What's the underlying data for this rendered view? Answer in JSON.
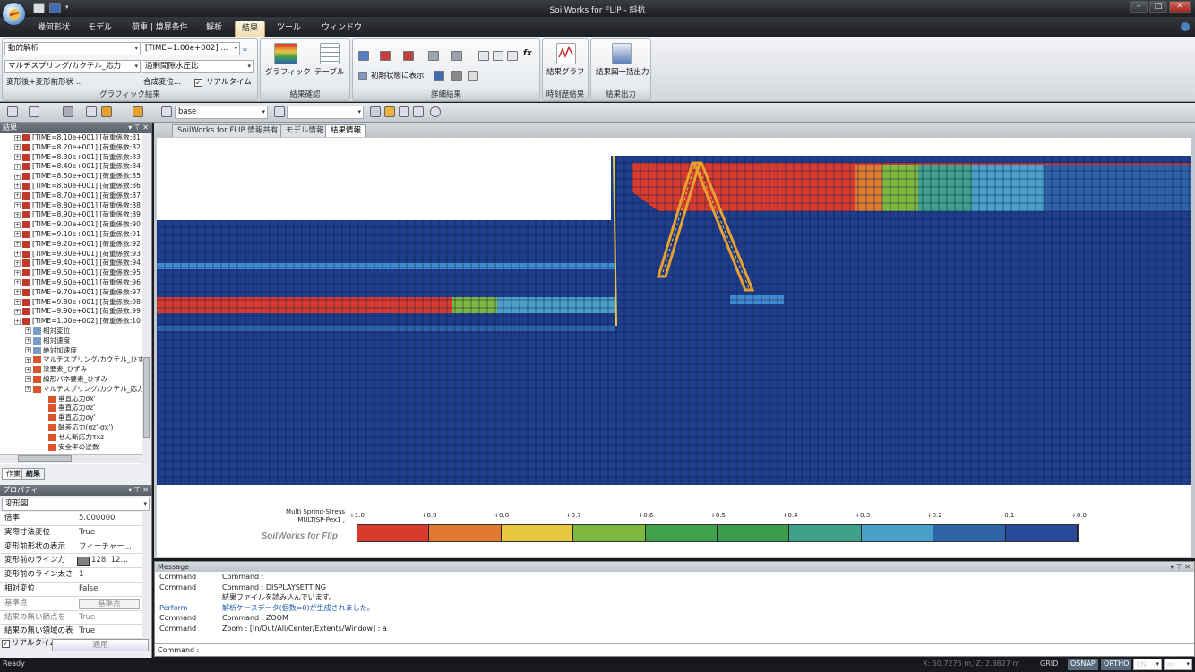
{
  "app": {
    "title": "SoilWorks for FLIP - 斜杭"
  },
  "ribbon": {
    "tabs": [
      "幾何形状",
      "モデル",
      "荷重 | 境界条件",
      "解析",
      "結果",
      "ツール",
      "ウィンドウ"
    ],
    "active_tab": "結果",
    "graphic_result": {
      "analysis_combo": "動的解析",
      "time_combo": "[TIME=1.00e+002]  ...",
      "component_combo": "マルチスプリング/カクテル_応力",
      "excess_combo": "過剰間隙水圧比",
      "shape_combo": "変形後+変形前形状 ...",
      "displacement_combo": "合成変位...",
      "realtime_label": "リアルタイム",
      "group_label": "グラフィック結果"
    },
    "result_check": {
      "graphic_label": "グラフィック",
      "table_label": "テーブル",
      "group_label": "結果確認"
    },
    "detail_result": {
      "show_initial_label": "初期状態に表示",
      "group_label": "詳細結果"
    },
    "timehistory": {
      "graph_label": "結果グラフ",
      "group_label": "時刻歴結果"
    },
    "output": {
      "batch_label": "結果図一括出力",
      "group_label": "結果出力"
    }
  },
  "toolbar": {
    "layer_combo": "base"
  },
  "result_panel": {
    "title": "結果",
    "rows": [
      "[TIME=8.10e+001]  [荷重係数:81",
      "[TIME=8.20e+001]  [荷重係数:82",
      "[TIME=8.30e+001]  [荷重係数:83",
      "[TIME=8.40e+001]  [荷重係数:84",
      "[TIME=8.50e+001]  [荷重係数:85",
      "[TIME=8.60e+001]  [荷重係数:86",
      "[TIME=8.70e+001]  [荷重係数:87",
      "[TIME=8.80e+001]  [荷重係数:88",
      "[TIME=8.90e+001]  [荷重係数:89",
      "[TIME=9.00e+001]  [荷重係数:90",
      "[TIME=9.10e+001]  [荷重係数:91",
      "[TIME=9.20e+001]  [荷重係数:92",
      "[TIME=9.30e+001]  [荷重係数:93",
      "[TIME=9.40e+001]  [荷重係数:94",
      "[TIME=9.50e+001]  [荷重係数:95",
      "[TIME=9.60e+001]  [荷重係数:96",
      "[TIME=9.70e+001]  [荷重係数:97",
      "[TIME=9.80e+001]  [荷重係数:98",
      "[TIME=9.90e+001]  [荷重係数:99",
      "[TIME=1.00e+002]  [荷重係数:10"
    ],
    "sub_rows": [
      "相対変位",
      "相対速度",
      "絶対加速度",
      "マルチスプリング/カクテル_ひずみ",
      "梁要素_ひずみ",
      "線形バネ要素_ひずみ",
      "マルチスプリング/カクテル_応力"
    ],
    "leaf_rows": [
      "垂直応力σx'",
      "垂直応力σz'",
      "垂直応力σy'",
      "軸差応力(σz'-σx')",
      "せん断応力τxz",
      "安全率の逆数"
    ],
    "tabs": [
      "作業",
      "結果"
    ]
  },
  "property_panel": {
    "title": "プロパティ",
    "combo": "変形図",
    "rows": [
      {
        "key": "倍率",
        "value": "5.000000"
      },
      {
        "key": "実際寸法変位",
        "value": "True"
      },
      {
        "key": "変形前形状の表示",
        "value": "フィーチャー..."
      },
      {
        "key": "変形前のライン力",
        "value": "128, 12..."
      },
      {
        "key": "変形前のライン太さ",
        "value": "1"
      },
      {
        "key": "相対変位",
        "value": "False"
      },
      {
        "key": "基準点",
        "value": "基準点"
      },
      {
        "key": "結果の無い節点を",
        "value": "True"
      },
      {
        "key": "結果の無い領域の表",
        "value": "True"
      }
    ],
    "realtime_label": "リアルタイム",
    "apply_label": "適用"
  },
  "doc_tabs": [
    "SoilWorks for FLIP 情報共有",
    "モデル情報",
    "結果情報"
  ],
  "doc_active": "結果情報",
  "legend": {
    "title1": "Multi Spring-Stress",
    "title2": "MULTISP-Pex1 ,",
    "brand": "SoilWorks for Flip",
    "ticks": [
      "+1.0",
      "+0.9",
      "+0.8",
      "+0.7",
      "+0.6",
      "+0.5",
      "+0.4",
      "+0.3",
      "+0.2",
      "+0.1",
      "+0.0"
    ],
    "colors": [
      "#d93a2e",
      "#e07a32",
      "#e8c840",
      "#7fb83e",
      "#3fa14a",
      "#3c9a4c",
      "#3fa08c",
      "#4aa0c8",
      "#2e63a8",
      "#284a98"
    ]
  },
  "message": {
    "title": "Message",
    "rows": [
      {
        "k": "Command",
        "v": "Command :",
        "c": "#222"
      },
      {
        "k": "Command",
        "v": "Command : DISPLAYSETTING",
        "c": "#222"
      },
      {
        "k": "",
        "v": "結果ファイルを読み込んでいます。",
        "c": "#222"
      },
      {
        "k": "Perform",
        "v": "解析ケースデータ(個数=0)が生成されました。",
        "c": "#1e5aa8"
      },
      {
        "k": "Command",
        "v": "Command : ZOOM",
        "c": "#222"
      },
      {
        "k": "Command",
        "v": "Zoom : [In/Out/All/Center/Extents/Window] : a",
        "c": "#222"
      }
    ],
    "prompt": "Command :"
  },
  "status": {
    "ready": "Ready",
    "coords": "X: 50.7275 m,  Z: 2.3827 m",
    "grid": "GRID",
    "osnap": "OSNAP",
    "ortho": "ORTHO",
    "unit_force": "kN",
    "unit_len": "m"
  }
}
